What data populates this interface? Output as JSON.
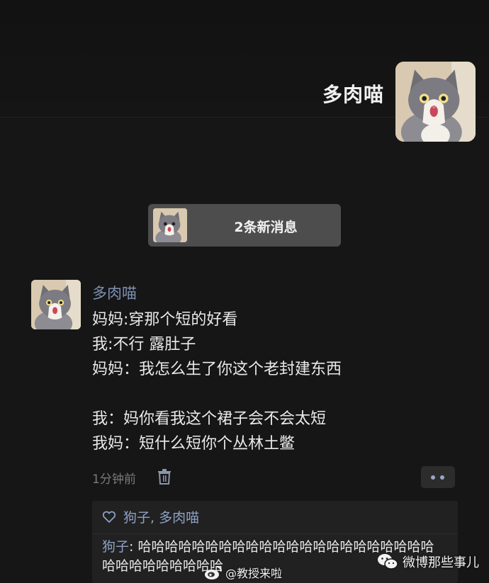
{
  "header": {
    "name": "多肉喵"
  },
  "new_messages": {
    "label": "2条新消息"
  },
  "post": {
    "author": "多肉喵",
    "lines": [
      "妈妈:穿那个短的好看",
      "我:不行 露肚子",
      "妈妈：我怎么生了你这个老封建东西",
      "",
      "我：妈你看我这个裙子会不会太短",
      "我妈：短什么短你个丛林土鳖"
    ],
    "time": "1分钟前",
    "icons": {
      "delete": "trash-icon",
      "more": "more-dots-icon"
    }
  },
  "comments": {
    "likes": "狗子, 多肉喵",
    "comment_author": "狗子",
    "comment_sep": ": ",
    "comment_text": "哈哈哈哈哈哈哈哈哈哈哈哈哈哈哈哈哈哈哈哈哈哈哈哈哈哈哈哈哈哈哈"
  },
  "watermarks": {
    "weibo": "@教授来啦",
    "wechat": "微博那些事儿"
  },
  "colors": {
    "background": "#161616",
    "link_blue": "#8ea0c6",
    "banner": "#4d4d4d"
  }
}
